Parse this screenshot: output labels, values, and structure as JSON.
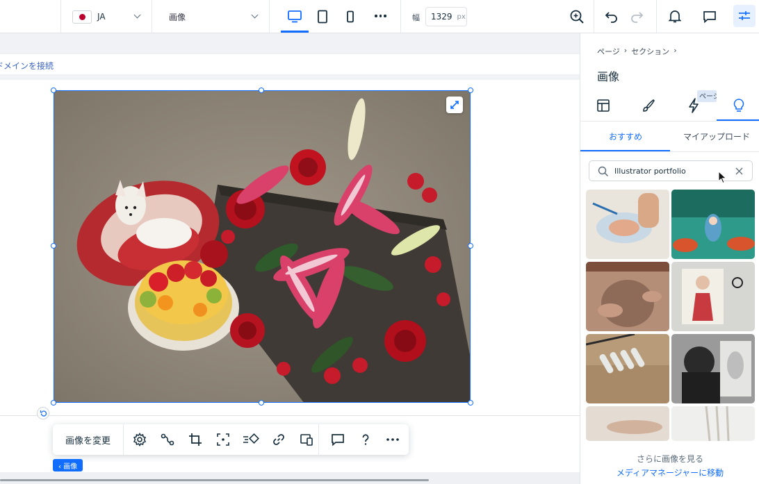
{
  "topbar": {
    "language": "JA",
    "page_selector": "画像",
    "width_label": "幅",
    "width_value": "1329",
    "width_unit": "px"
  },
  "canvas": {
    "domain_link": "ドメインを接続",
    "toolbar": {
      "change_image": "画像を変更"
    },
    "element_tag": "‹ 画像"
  },
  "panel": {
    "breadcrumb": [
      "ページ",
      "セクション"
    ],
    "title": "画像",
    "tooltip": "ページ",
    "subtabs": [
      "おすすめ",
      "マイアップロード"
    ],
    "search": {
      "value": "Illustrator portfolio"
    },
    "more_title": "さらに画像を見る",
    "more_link": "メディアマネージャーに移動"
  },
  "colors": {
    "accent": "#116dff",
    "selection": "#e7f0ff",
    "text": "#162d3d"
  }
}
